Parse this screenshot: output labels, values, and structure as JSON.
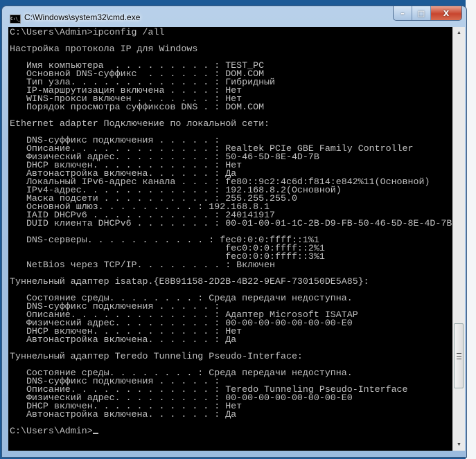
{
  "window": {
    "title": "C:\\Windows\\system32\\cmd.exe",
    "icon_text": "C:\\_",
    "minimize": "–",
    "maximize": "□",
    "close": "X"
  },
  "console": {
    "lines": [
      "C:\\Users\\Admin>ipconfig /all",
      "",
      "Настройка протокола IP для Windows",
      "",
      "   Имя компьютера  . . . . . . . . . : TEST_PC",
      "   Основной DNS-суффикс  . . . . . . : DOM.COM",
      "   Тип узла. . . . . . . . . . . . . : Гибридный",
      "   IP-маршрутизация включена . . . . : Нет",
      "   WINS-прокси включен . . . . . . . : Нет",
      "   Порядок просмотра суффиксов DNS . : DOM.COM",
      "",
      "Ethernet adapter Подключение по локальной сети:",
      "",
      "   DNS-суффикс подключения . . . . . :",
      "   Описание. . . . . . . . . . . . . : Realtek PCIe GBE Family Controller",
      "   Физический адрес. . . . . . . . . : 50-46-5D-8E-4D-7B",
      "   DHCP включен. . . . . . . . . . . : Нет",
      "   Автонастройка включена. . . . . . : Да",
      "   Локальный IPv6-адрес канала . . . : fe80::9c2:4c6d:f814:e842%11(Основной)",
      "   IPv4-адрес. . . . . . . . . . . . : 192.168.8.2(Основной)",
      "   Маска подсети . . . . . . . . . . : 255.255.255.0",
      "   Основной шлюз. . . . . . . . . : 192.168.8.1",
      "   IAID DHCPv6 . . . . . . . . . . . : 240141917",
      "   DUID клиента DHCPv6 . . . . . . . : 00-01-00-01-1C-2B-D9-FB-50-46-5D-8E-4D-7B",
      "",
      "   DNS-серверы. . . . . . . . . . . : fec0:0:0:ffff::1%1",
      "                                       fec0:0:0:ffff::2%1",
      "                                       fec0:0:0:ffff::3%1",
      "   NetBios через TCP/IP. . . . . . . . : Включен",
      "",
      "Туннельный адаптер isatap.{E8B91158-2D2B-4B22-9EAF-730150DE5A85}:",
      "",
      "   Состояние среды. . . . . . . . : Среда передачи недоступна.",
      "   DNS-суффикс подключения . . . . . :",
      "   Описание. . . . . . . . . . . . . : Адаптер Microsoft ISATAP",
      "   Физический адрес. . . . . . . . . : 00-00-00-00-00-00-00-E0",
      "   DHCP включен. . . . . . . . . . . : Нет",
      "   Автонастройка включена. . . . . . : Да",
      "",
      "Туннельный адаптер Teredo Tunneling Pseudo-Interface:",
      "",
      "   Состояние среды. . . . . . . . : Среда передачи недоступна.",
      "   DNS-суффикс подключения . . . . . :",
      "   Описание. . . . . . . . . . . . . : Teredo Tunneling Pseudo-Interface",
      "   Физический адрес. . . . . . . . . : 00-00-00-00-00-00-00-E0",
      "   DHCP включен. . . . . . . . . . . : Нет",
      "   Автонастройка включена. . . . . . : Да",
      ""
    ],
    "prompt": "C:\\Users\\Admin>"
  },
  "scrollbar": {
    "up": "▲",
    "down": "▼",
    "position_fraction": 0.85
  }
}
